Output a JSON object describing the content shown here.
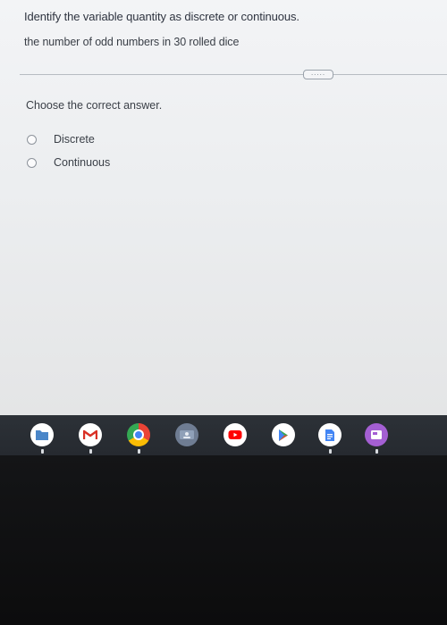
{
  "question": {
    "prompt": "Identify the variable quantity as discrete or continuous.",
    "text": "the number of odd numbers in 30 rolled dice",
    "more_label": "....."
  },
  "answer": {
    "instruction": "Choose the correct answer.",
    "options": [
      {
        "label": "Discrete",
        "selected": false
      },
      {
        "label": "Continuous",
        "selected": false
      }
    ]
  },
  "shelf": {
    "apps": [
      {
        "name": "files-icon",
        "color": "#4a86c8"
      },
      {
        "name": "gmail-icon",
        "color": "#ffffff"
      },
      {
        "name": "chrome-icon",
        "color": "#e8eaed"
      },
      {
        "name": "classroom-icon",
        "color": "#5f6f8a"
      },
      {
        "name": "youtube-icon",
        "color": "#ffffff"
      },
      {
        "name": "play-store-icon",
        "color": "#ffffff"
      },
      {
        "name": "docs-icon",
        "color": "#ffffff"
      },
      {
        "name": "screencast-icon",
        "color": "#a15fd0"
      }
    ]
  }
}
